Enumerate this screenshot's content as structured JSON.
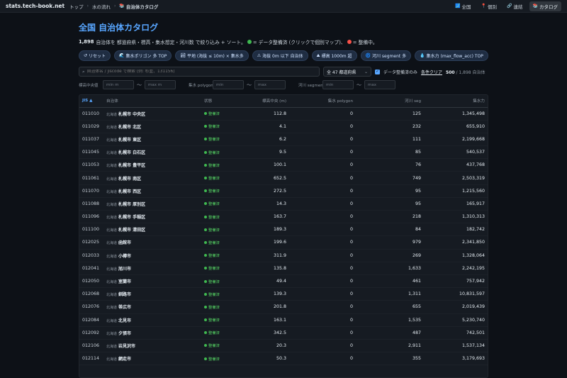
{
  "topbar": {
    "brand": "stats.tech-book.net",
    "breadcrumbs": [
      "トップ",
      "水の流れ",
      "自治体カタログ"
    ],
    "nav": [
      {
        "label": "全国",
        "icon": "map-icon",
        "glyph": "🗾",
        "active": false
      },
      {
        "label": "個別",
        "icon": "pin-icon",
        "glyph": "📍",
        "active": false
      },
      {
        "label": "連結",
        "icon": "link-icon",
        "glyph": "🔗",
        "active": false
      },
      {
        "label": "カタログ",
        "icon": "catalog-icon",
        "glyph": "📚",
        "active": true
      }
    ]
  },
  "header": {
    "title": "全国 自治体カタログ",
    "total_count": "1,898",
    "desc_part1": "自治体を 都道府県・標高・集水想定・河川数 で絞り込み + ソート。",
    "desc_part2": "= データ整備済 (クリックで個別マップ)、",
    "desc_part3": "= 整備中。",
    "ready_color": "#3fb950",
    "pending_color": "#f85149"
  },
  "chips": [
    {
      "label": "リセット",
      "icon": "reset-icon",
      "glyph": "↺"
    },
    {
      "label": "集水ポリゴン 多 TOP",
      "icon": "wave-icon",
      "glyph": "🌊"
    },
    {
      "label": "平地 (海抜 ≤ 10m) × 集水多",
      "icon": "landscape-icon",
      "glyph": "🏞"
    },
    {
      "label": "海抜 0m 以下 自治体",
      "icon": "warning-icon",
      "glyph": "⚠"
    },
    {
      "label": "標高 1000m 超",
      "icon": "mountain-icon",
      "glyph": "⛰"
    },
    {
      "label": "河川 segment 多",
      "icon": "river-icon",
      "glyph": "🌀"
    },
    {
      "label": "集水力 (max_flow_acc) TOP",
      "icon": "droplet-icon",
      "glyph": "💧"
    }
  ],
  "filters": {
    "search_placeholder": "自治体名 / jiscode で検索 (例: 杉並、131156)",
    "prefecture_select": "全 47 都道府県",
    "only_ready_label": "データ整備済のみ",
    "clear_label": "条件クリア",
    "shown": "500",
    "total": "/ 1,898 自治体",
    "ranges": [
      {
        "label": "標高中央値",
        "min": "min m",
        "max": "max m"
      },
      {
        "label": "集水 polygon",
        "min": "min",
        "max": "max"
      },
      {
        "label": "河川 segment",
        "min": "min",
        "max": "max"
      }
    ]
  },
  "table": {
    "headers": {
      "jis": "JIS ▲",
      "name": "自治体",
      "status": "状態",
      "elev": "標高中央 (m)",
      "poly": "集水 polygon",
      "seg": "河川 seg",
      "flow": "集水力"
    },
    "rows": [
      {
        "jis": "011010",
        "pref": "北海道",
        "name": "札幌市 中央区",
        "status": "整備済",
        "elev": "112.8",
        "poly": "0",
        "seg": "125",
        "flow": "1,345,498"
      },
      {
        "jis": "011029",
        "pref": "北海道",
        "name": "札幌市 北区",
        "status": "整備済",
        "elev": "4.1",
        "poly": "0",
        "seg": "232",
        "flow": "655,910"
      },
      {
        "jis": "011037",
        "pref": "北海道",
        "name": "札幌市 東区",
        "status": "整備済",
        "elev": "6.2",
        "poly": "0",
        "seg": "111",
        "flow": "2,199,668"
      },
      {
        "jis": "011045",
        "pref": "北海道",
        "name": "札幌市 白石区",
        "status": "整備済",
        "elev": "9.5",
        "poly": "0",
        "seg": "85",
        "flow": "540,537"
      },
      {
        "jis": "011053",
        "pref": "北海道",
        "name": "札幌市 豊平区",
        "status": "整備済",
        "elev": "100.1",
        "poly": "0",
        "seg": "76",
        "flow": "437,768"
      },
      {
        "jis": "011061",
        "pref": "北海道",
        "name": "札幌市 南区",
        "status": "整備済",
        "elev": "652.5",
        "poly": "0",
        "seg": "749",
        "flow": "2,503,319"
      },
      {
        "jis": "011070",
        "pref": "北海道",
        "name": "札幌市 西区",
        "status": "整備済",
        "elev": "272.5",
        "poly": "0",
        "seg": "95",
        "flow": "1,215,560"
      },
      {
        "jis": "011088",
        "pref": "北海道",
        "name": "札幌市 厚別区",
        "status": "整備済",
        "elev": "14.3",
        "poly": "0",
        "seg": "95",
        "flow": "165,917"
      },
      {
        "jis": "011096",
        "pref": "北海道",
        "name": "札幌市 手稲区",
        "status": "整備済",
        "elev": "163.7",
        "poly": "0",
        "seg": "218",
        "flow": "1,310,313"
      },
      {
        "jis": "011100",
        "pref": "北海道",
        "name": "札幌市 清田区",
        "status": "整備済",
        "elev": "189.3",
        "poly": "0",
        "seg": "84",
        "flow": "182,742"
      },
      {
        "jis": "012025",
        "pref": "北海道",
        "name": "函館市",
        "status": "整備済",
        "elev": "199.6",
        "poly": "0",
        "seg": "979",
        "flow": "2,341,850"
      },
      {
        "jis": "012033",
        "pref": "北海道",
        "name": "小樽市",
        "status": "整備済",
        "elev": "311.9",
        "poly": "0",
        "seg": "269",
        "flow": "1,328,064"
      },
      {
        "jis": "012041",
        "pref": "北海道",
        "name": "旭川市",
        "status": "整備済",
        "elev": "135.8",
        "poly": "0",
        "seg": "1,633",
        "flow": "2,242,195"
      },
      {
        "jis": "012050",
        "pref": "北海道",
        "name": "室蘭市",
        "status": "整備済",
        "elev": "49.4",
        "poly": "0",
        "seg": "461",
        "flow": "757,942"
      },
      {
        "jis": "012068",
        "pref": "北海道",
        "name": "釧路市",
        "status": "整備済",
        "elev": "139.3",
        "poly": "0",
        "seg": "1,311",
        "flow": "10,831,597"
      },
      {
        "jis": "012076",
        "pref": "北海道",
        "name": "帯広市",
        "status": "整備済",
        "elev": "201.8",
        "poly": "0",
        "seg": "655",
        "flow": "2,019,439"
      },
      {
        "jis": "012084",
        "pref": "北海道",
        "name": "北見市",
        "status": "整備済",
        "elev": "163.1",
        "poly": "0",
        "seg": "1,535",
        "flow": "5,230,740"
      },
      {
        "jis": "012092",
        "pref": "北海道",
        "name": "夕張市",
        "status": "整備済",
        "elev": "342.5",
        "poly": "0",
        "seg": "487",
        "flow": "742,501"
      },
      {
        "jis": "012106",
        "pref": "北海道",
        "name": "岩見沢市",
        "status": "整備済",
        "elev": "20.3",
        "poly": "0",
        "seg": "2,911",
        "flow": "1,537,134"
      },
      {
        "jis": "012114",
        "pref": "北海道",
        "name": "網走市",
        "status": "整備済",
        "elev": "50.3",
        "poly": "0",
        "seg": "355",
        "flow": "3,179,693"
      }
    ]
  }
}
